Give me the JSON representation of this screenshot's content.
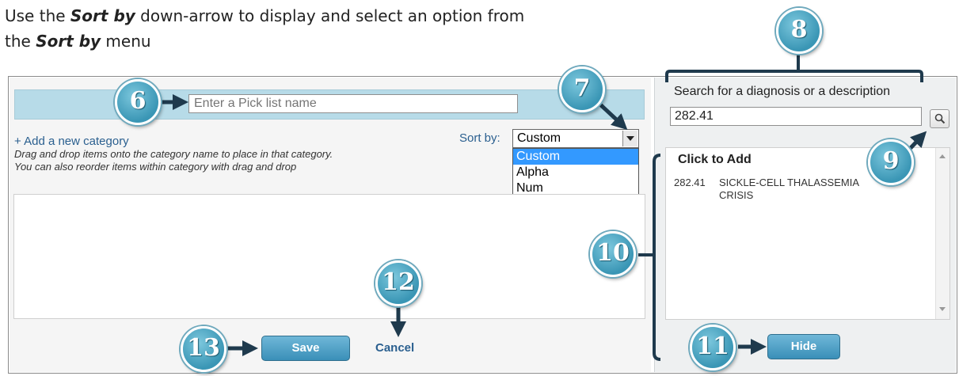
{
  "instruction": {
    "line1_pre": "Use the ",
    "line1_bold": "Sort by",
    "line1_post": " down-arrow to display and select an option from",
    "line2_pre": "the ",
    "line2_bold": "Sort by",
    "line2_post": " menu"
  },
  "picklist": {
    "name_placeholder": "Enter a Pick list name",
    "add_category": "+ Add a new category",
    "hint_line1": "Drag and drop items onto the category name to place in that category.",
    "hint_line2": "You can also reorder items within category with drag and drop",
    "sort_label": "Sort by:",
    "sort_value": "Custom",
    "sort_options": [
      "Custom",
      "Alpha",
      "Num"
    ],
    "save_label": "Save",
    "cancel_label": "Cancel"
  },
  "search": {
    "label": "Search for a diagnosis or a description",
    "value": "282.41",
    "results_title": "Click to Add",
    "results": [
      {
        "code": "282.41",
        "description_line1": "SICKLE-CELL THALASSEMIA",
        "description_line2": "CRISIS"
      }
    ],
    "hide_label": "Hide"
  },
  "callouts": [
    "6",
    "7",
    "8",
    "9",
    "10",
    "11",
    "12",
    "13"
  ],
  "colors": {
    "header_bar": "#b7dbe8",
    "callout": "#3a96b5",
    "button": "#3a8fb8",
    "link": "#2a5f8f",
    "annotation": "#1f3a4d"
  },
  "icons": {
    "search_button": "magnifier-icon",
    "dropdown": "chevron-down-icon"
  }
}
